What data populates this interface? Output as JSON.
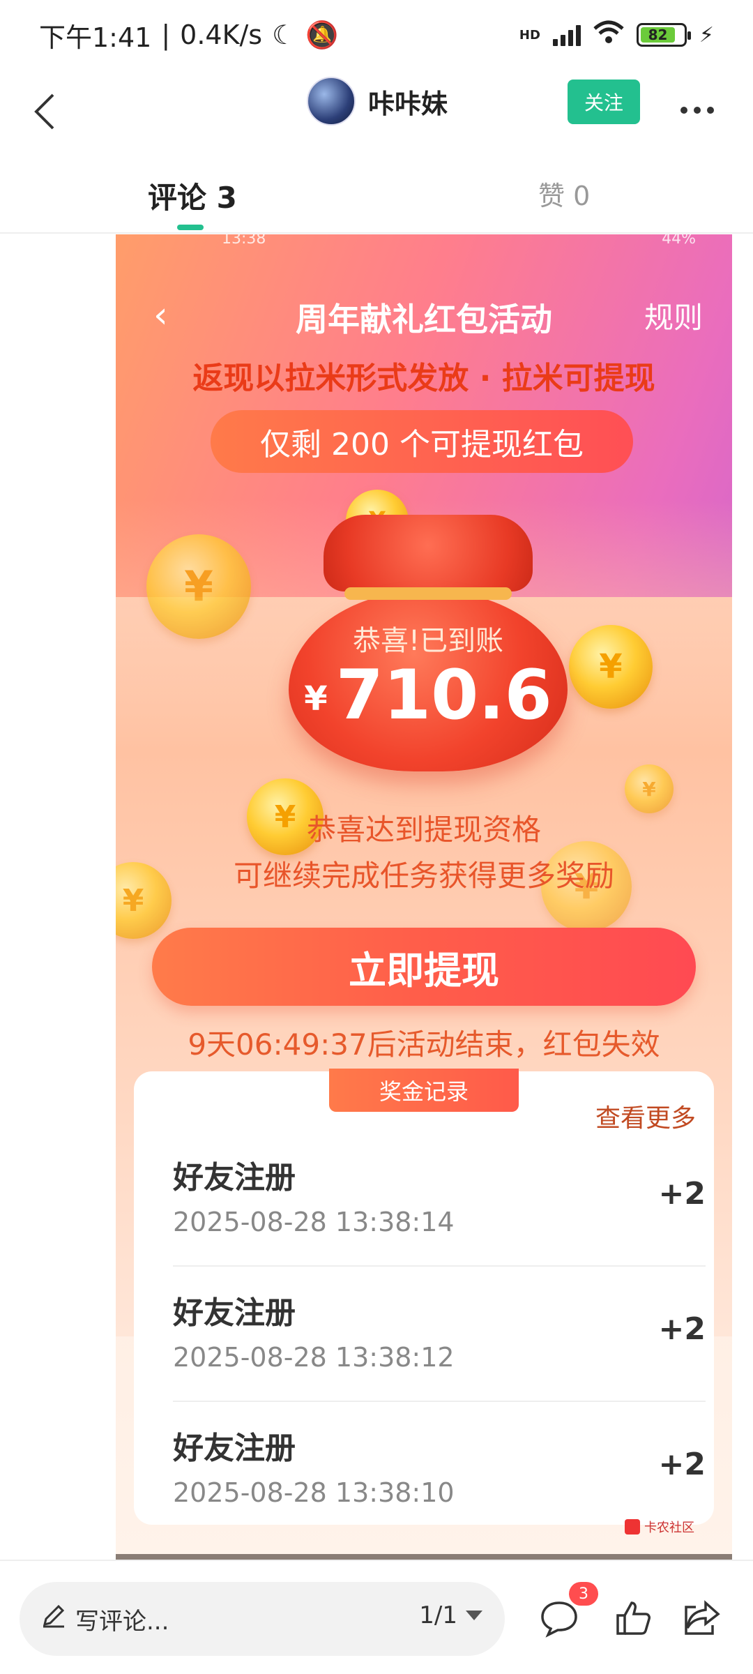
{
  "status_bar": {
    "time": "下午1:41",
    "speed": "0.4K/s",
    "network": "HD",
    "battery": "82"
  },
  "header": {
    "username": "咔咔妹",
    "follow_label": "关注"
  },
  "tabs": {
    "comments": "评论 3",
    "likes": "赞 0"
  },
  "embedded": {
    "status_time": "13:38",
    "status_battery": "44%",
    "title": "周年献礼红包活动",
    "rules": "规则",
    "subtitle": "返现以拉米形式发放 · 拉米可提现",
    "remaining": "仅剩 200 个可提现红包",
    "bag_message": "恭喜!已到账",
    "currency": "¥",
    "amount": "710.6",
    "qualify_line1": "恭喜达到提现资格",
    "qualify_line2": "可继续完成任务获得更多奖励",
    "withdraw_button": "立即提现",
    "countdown": "9天06:49:37后活动结束，红包失效",
    "records_title": "奖金记录",
    "records_more": "查看更多",
    "records": [
      {
        "title": "好友注册",
        "time": "2025-08-28 13:38:14",
        "amount": "+2"
      },
      {
        "title": "好友注册",
        "time": "2025-08-28 13:38:12",
        "amount": "+2"
      },
      {
        "title": "好友注册",
        "time": "2025-08-28 13:38:10",
        "amount": "+2"
      }
    ],
    "watermark": "卡农社区"
  },
  "bottom_bar": {
    "comment_placeholder": "写评论...",
    "pager": "1/1",
    "comment_count": "3"
  },
  "colors": {
    "accent_green": "#23c08f",
    "red_accent": "#ea3b18",
    "badge_red": "#ff4d4f"
  },
  "icons": [
    "back-icon",
    "more-icon",
    "pencil-icon",
    "comment-icon",
    "like-icon",
    "share-icon"
  ]
}
